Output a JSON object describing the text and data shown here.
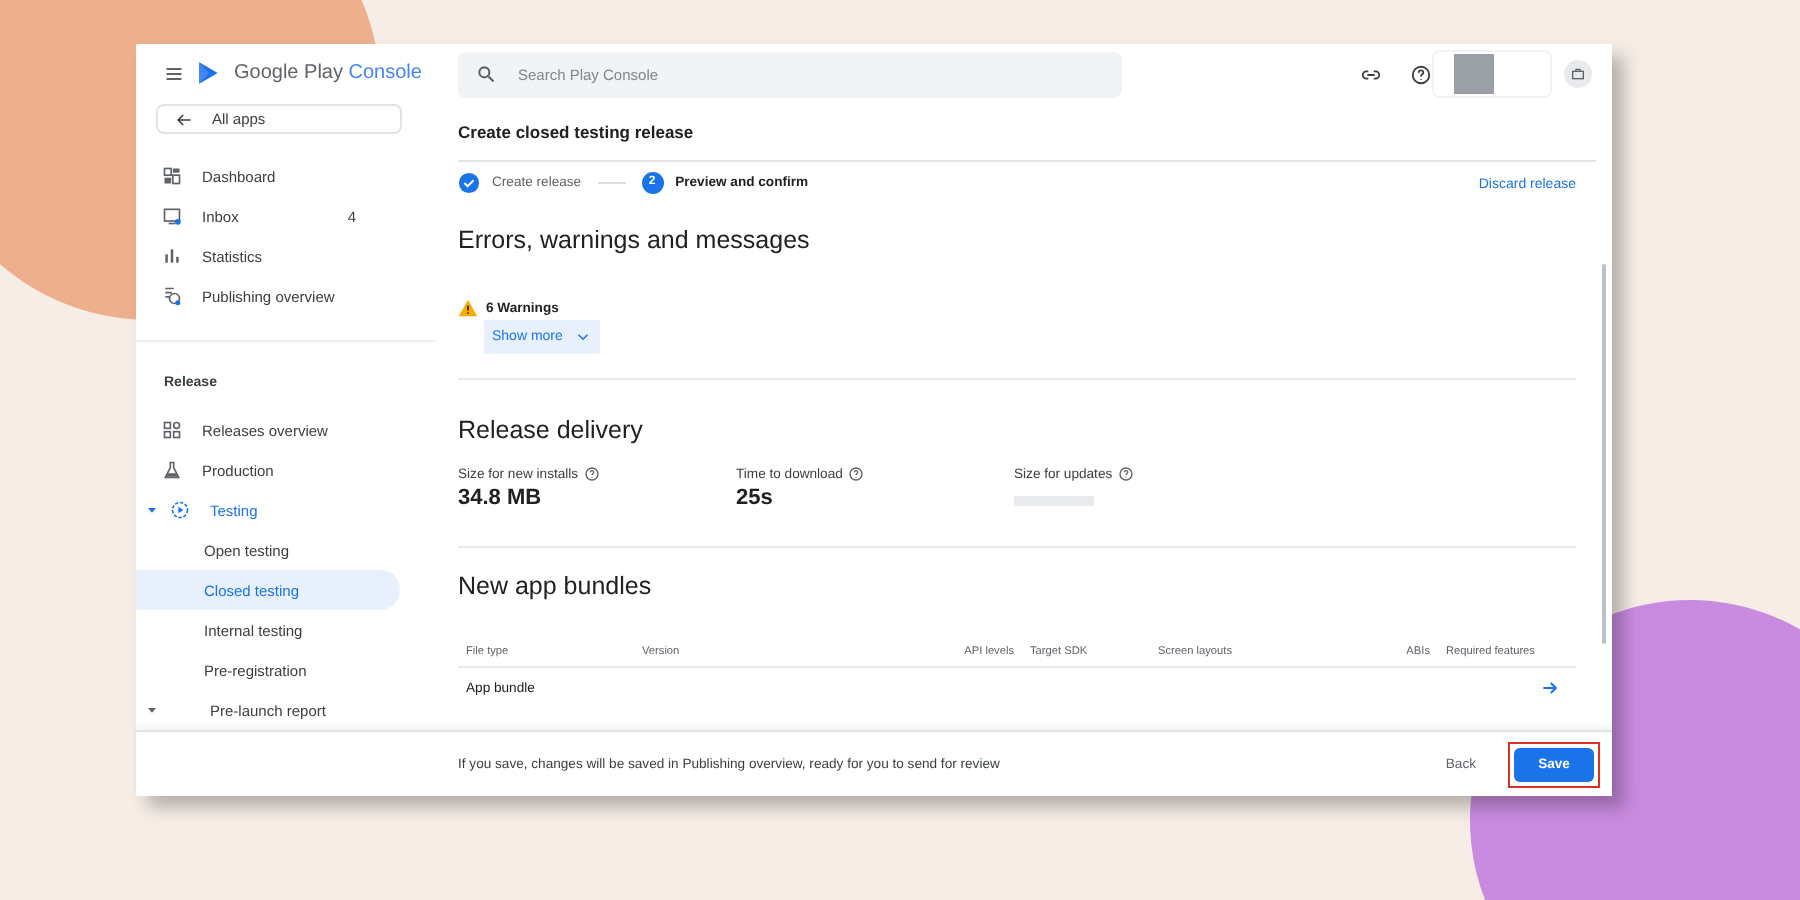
{
  "app": {
    "brand_prefix": "Google Play",
    "brand_suffix": "Console",
    "back_link": "All apps"
  },
  "sidebar": {
    "items": [
      {
        "kind": "item",
        "label": "Dashboard",
        "selected": false
      },
      {
        "kind": "item",
        "label": "Inbox",
        "badge": "4",
        "selected": false
      },
      {
        "kind": "item",
        "label": "Statistics",
        "selected": false
      },
      {
        "kind": "item",
        "label": "Publishing overview",
        "selected": false
      },
      {
        "kind": "section",
        "label": "Release"
      },
      {
        "kind": "item",
        "label": "Releases overview",
        "selected": false
      },
      {
        "kind": "item",
        "label": "Production",
        "selected": false
      },
      {
        "kind": "group",
        "label": "Testing",
        "expanded": true,
        "selected": false,
        "children": [
          {
            "label": "Open testing",
            "selected": false
          },
          {
            "label": "Closed testing",
            "selected": true
          },
          {
            "label": "Internal testing",
            "selected": false
          },
          {
            "label": "Pre-registration",
            "selected": false
          }
        ]
      },
      {
        "kind": "group",
        "label": "Pre-launch report",
        "expanded": false,
        "selected": false
      }
    ]
  },
  "search": {
    "placeholder": "Search Play Console"
  },
  "page": {
    "title": "Create closed testing release",
    "steps": [
      {
        "label": "Create release",
        "done": true
      },
      {
        "number": "2",
        "label": "Preview and confirm",
        "done": false
      }
    ],
    "discard_link": "Discard release"
  },
  "messages": {
    "heading": "Errors, warnings and messages",
    "warning": "6 Warnings",
    "show_more": "Show more"
  },
  "delivery": {
    "heading": "Release delivery",
    "metrics": [
      {
        "label": "Size for new installs",
        "value": "34.8 MB"
      },
      {
        "label": "Time to download",
        "value": "25s"
      },
      {
        "label": "Size for updates"
      }
    ]
  },
  "bundles": {
    "heading": "New app bundles",
    "columns": [
      "File type",
      "Version",
      "API levels",
      "Target SDK",
      "Screen layouts",
      "ABIs",
      "Required features"
    ],
    "rows": [
      {
        "file_type": "App bundle"
      }
    ]
  },
  "footer": {
    "note": "If you save, changes will be saved in Publishing overview, ready for you to send for review",
    "back": "Back",
    "save": "Save",
    "save_highlighted": true
  }
}
